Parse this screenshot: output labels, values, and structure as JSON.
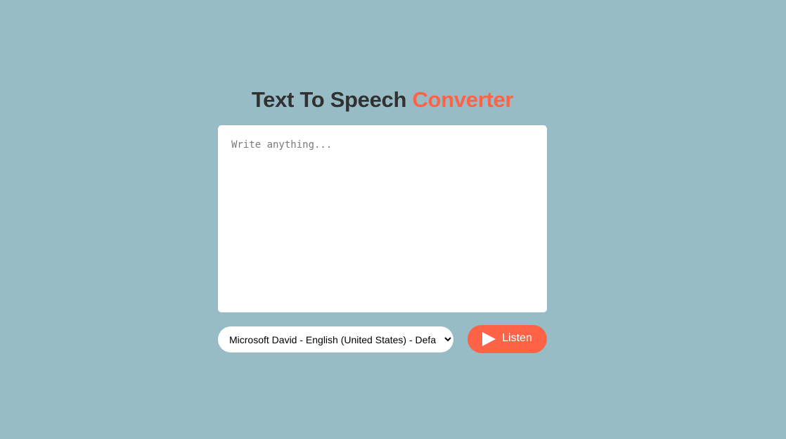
{
  "header": {
    "title_main": "Text To Speech",
    "title_accent": "Converter"
  },
  "textarea": {
    "placeholder": "Write anything...",
    "value": ""
  },
  "voice_select": {
    "selected": "Microsoft David - English (United States) - Default"
  },
  "listen_button": {
    "label": "Listen",
    "icon": "play-icon"
  },
  "colors": {
    "background": "#97bcc5",
    "accent": "#ff6347",
    "title_text": "#313131"
  }
}
